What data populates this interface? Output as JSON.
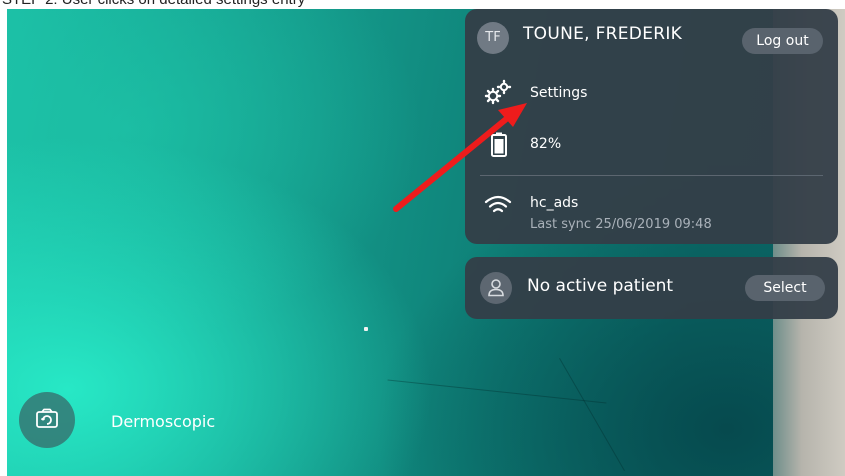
{
  "caption": "STEP 2: User clicks on detailed settings entry",
  "user": {
    "initials": "TF",
    "name": "TOUNE, FREDERIK",
    "logout_label": "Log out"
  },
  "menu": {
    "settings_label": "Settings",
    "battery_value": "82%",
    "wifi_name": "hc_ads",
    "last_sync": "Last sync 25/06/2019 09:48"
  },
  "patient": {
    "status": "No active patient",
    "select_label": "Select"
  },
  "mode": {
    "label": "Dermoscopic"
  },
  "icons": {
    "settings": "gears-icon",
    "battery": "battery-icon",
    "wifi": "wifi-icon",
    "patient": "person-icon",
    "camera_switch": "camera-switch-icon"
  },
  "colors": {
    "panel": "#343e48",
    "button": "#59636d",
    "arrow": "#ee1c1c",
    "camera_teal": "#14998a"
  }
}
